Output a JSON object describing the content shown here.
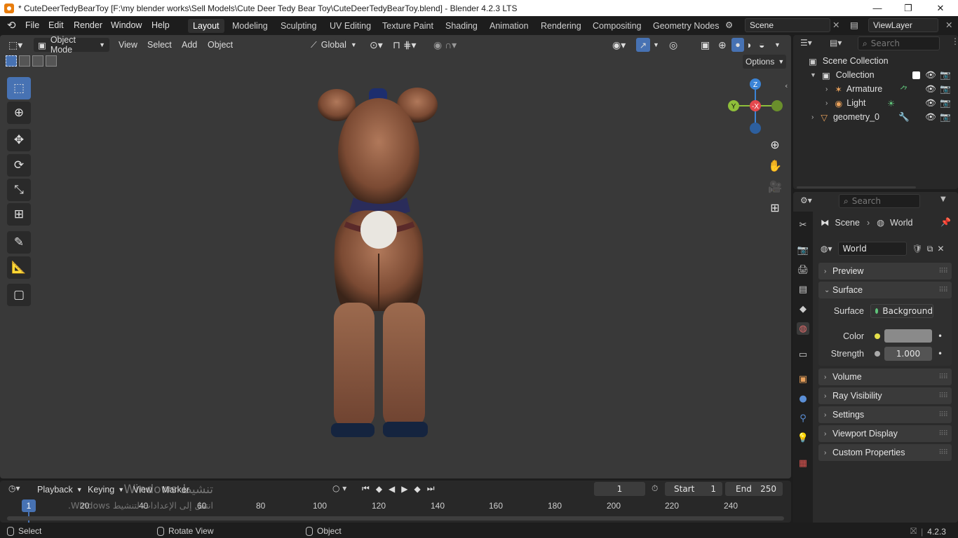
{
  "window": {
    "title": "* CuteDeerTedyBearToy [F:\\my blender works\\Sell Models\\Cute Deer Tedy Bear Toy\\CuteDeerTedyBearToy.blend] - Blender 4.2.3 LTS",
    "minimize": "—",
    "maximize": "❐",
    "close": "✕"
  },
  "menu": {
    "file": "File",
    "edit": "Edit",
    "render": "Render",
    "window": "Window",
    "help": "Help"
  },
  "workspaces": [
    "Layout",
    "Modeling",
    "Sculpting",
    "UV Editing",
    "Texture Paint",
    "Shading",
    "Animation",
    "Rendering",
    "Compositing",
    "Geometry Nodes"
  ],
  "scene_field": "Scene",
  "viewlayer_field": "ViewLayer",
  "viewport": {
    "mode": "Object Mode",
    "view": "View",
    "select": "Select",
    "add": "Add",
    "object": "Object",
    "orientation": "Global",
    "options": "Options",
    "gizmo": {
      "z": "Z",
      "y": "Y",
      "x": "-X"
    }
  },
  "outliner": {
    "search_placeholder": "Search",
    "scene_collection": "Scene Collection",
    "collection": "Collection",
    "armature": "Armature",
    "light": "Light",
    "geometry": "geometry_0"
  },
  "properties": {
    "search_placeholder": "Search",
    "breadcrumb_scene": "Scene",
    "breadcrumb_world": "World",
    "world_name": "World",
    "panels": {
      "preview": "Preview",
      "surface": "Surface",
      "volume": "Volume",
      "ray_visibility": "Ray Visibility",
      "settings": "Settings",
      "viewport_display": "Viewport Display",
      "custom_properties": "Custom Properties"
    },
    "surface_label": "Surface",
    "surface_value": "Background",
    "color_label": "Color",
    "color_value": "#8a8a8a",
    "strength_label": "Strength",
    "strength_value": "1.000"
  },
  "timeline": {
    "playback": "Playback",
    "keying": "Keying",
    "view": "View",
    "marker": "Marker",
    "current_frame": "1",
    "start_label": "Start",
    "start_value": "1",
    "end_label": "End",
    "end_value": "250",
    "playhead": "1",
    "ticks": [
      "20",
      "40",
      "60",
      "80",
      "100",
      "120",
      "140",
      "160",
      "180",
      "200",
      "220",
      "240"
    ]
  },
  "watermark": {
    "line1": "تنشيط Windows",
    "line2": "انتقل إلى الإعدادات لتنشيط Windows."
  },
  "status": {
    "select": "Select",
    "rotate": "Rotate View",
    "object": "Object",
    "version": "4.2.3"
  },
  "colors": {
    "accent": "#4772b3",
    "axis_x": "#e5484d",
    "axis_y": "#8fbf3a",
    "axis_z": "#3b84d6",
    "viewport_bg": "#393939"
  }
}
